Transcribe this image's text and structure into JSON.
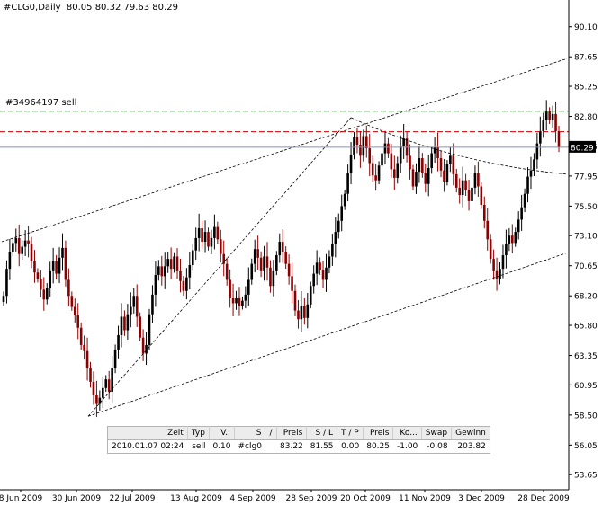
{
  "header": {
    "symbol": "#CLG0,Daily",
    "ohlc": "80.05 80.32 79.63 80.29"
  },
  "trade": {
    "label": "#34964197 sell",
    "columns": [
      "Zeit",
      "Typ",
      "V..",
      "S",
      "/",
      "Preis",
      "S / L",
      "T / P",
      "Preis",
      "Ko...",
      "Swap",
      "Gewinn"
    ],
    "row": [
      "2010.01.07 02:24",
      "sell",
      "0.10",
      "#clg0",
      "",
      "83.22",
      "81.55",
      "0.00",
      "80.25",
      "-1.00",
      "-0.08",
      "203.82"
    ]
  },
  "colors": {
    "bull": "#000000",
    "bear": "#8b0000",
    "stop": "#cc0000",
    "target": "#00a000",
    "current": "#8090b0",
    "price_tag": "#000000"
  },
  "chart_data": {
    "type": "candlestick",
    "title": "#CLG0,Daily",
    "ylim": [
      52.42,
      91.25
    ],
    "y_ticks": [
      90.1,
      87.65,
      85.25,
      82.8,
      80.35,
      77.95,
      75.5,
      73.1,
      70.65,
      68.2,
      65.8,
      63.35,
      60.95,
      58.5,
      56.05,
      53.65
    ],
    "x_ticks": [
      "8 Jun 2009",
      "30 Jun 2009",
      "22 Jul 2009",
      "13 Aug 2009",
      "4 Sep 2009",
      "28 Sep 2009",
      "20 Oct 2009",
      "11 Nov 2009",
      "3 Dec 2009",
      "28 Dec 2009"
    ],
    "current_price": 80.29,
    "levels": {
      "entry": 83.22,
      "stop_loss": 81.55,
      "current": 80.29
    },
    "grid": false,
    "closes": [
      68.2,
      70.4,
      71.8,
      72.5,
      72.9,
      71.6,
      72.2,
      72.7,
      72.4,
      71.0,
      70.1,
      69.6,
      68.7,
      67.9,
      68.8,
      70.2,
      71.0,
      70.0,
      71.3,
      72.1,
      69.5,
      68.2,
      67.3,
      66.6,
      65.6,
      64.2,
      63.7,
      62.3,
      61.2,
      60.1,
      59.4,
      59.9,
      60.7,
      61.4,
      60.4,
      62.3,
      63.8,
      65.0,
      66.5,
      65.4,
      66.7,
      67.3,
      68.2,
      66.5,
      64.8,
      63.5,
      64.2,
      66.7,
      68.3,
      69.9,
      70.6,
      69.8,
      70.6,
      71.2,
      70.4,
      71.4,
      70.2,
      69.4,
      68.6,
      69.7,
      70.7,
      71.9,
      72.9,
      73.7,
      72.6,
      73.4,
      72.2,
      72.9,
      73.8,
      72.8,
      71.6,
      70.8,
      69.5,
      68.0,
      67.6,
      68.0,
      67.4,
      67.8,
      68.3,
      69.5,
      70.8,
      72.0,
      71.3,
      70.2,
      71.4,
      70.5,
      69.0,
      70.2,
      71.5,
      72.6,
      71.8,
      70.8,
      69.8,
      68.6,
      67.0,
      66.3,
      67.4,
      66.4,
      67.5,
      69.0,
      70.0,
      70.9,
      70.3,
      69.5,
      70.5,
      71.4,
      72.4,
      73.4,
      74.3,
      75.5,
      76.5,
      78.2,
      79.7,
      81.1,
      80.5,
      79.6,
      81.2,
      80.2,
      79.0,
      78.0,
      77.6,
      78.8,
      79.8,
      80.6,
      79.8,
      78.5,
      77.8,
      79.0,
      80.4,
      81.0,
      79.6,
      78.5,
      77.1,
      78.3,
      79.4,
      78.2,
      77.3,
      78.6,
      79.8,
      80.3,
      79.4,
      78.4,
      77.5,
      78.9,
      79.6,
      78.1,
      77.0,
      76.4,
      77.6,
      76.8,
      75.9,
      77.0,
      78.2,
      77.1,
      75.6,
      74.3,
      72.8,
      71.2,
      70.2,
      69.6,
      70.4,
      71.5,
      72.4,
      73.1,
      72.5,
      73.4,
      74.4,
      75.4,
      76.5,
      77.9,
      78.4,
      79.3,
      80.6,
      81.6,
      82.5,
      83.2,
      82.5,
      83.0,
      81.6,
      80.3
    ]
  }
}
